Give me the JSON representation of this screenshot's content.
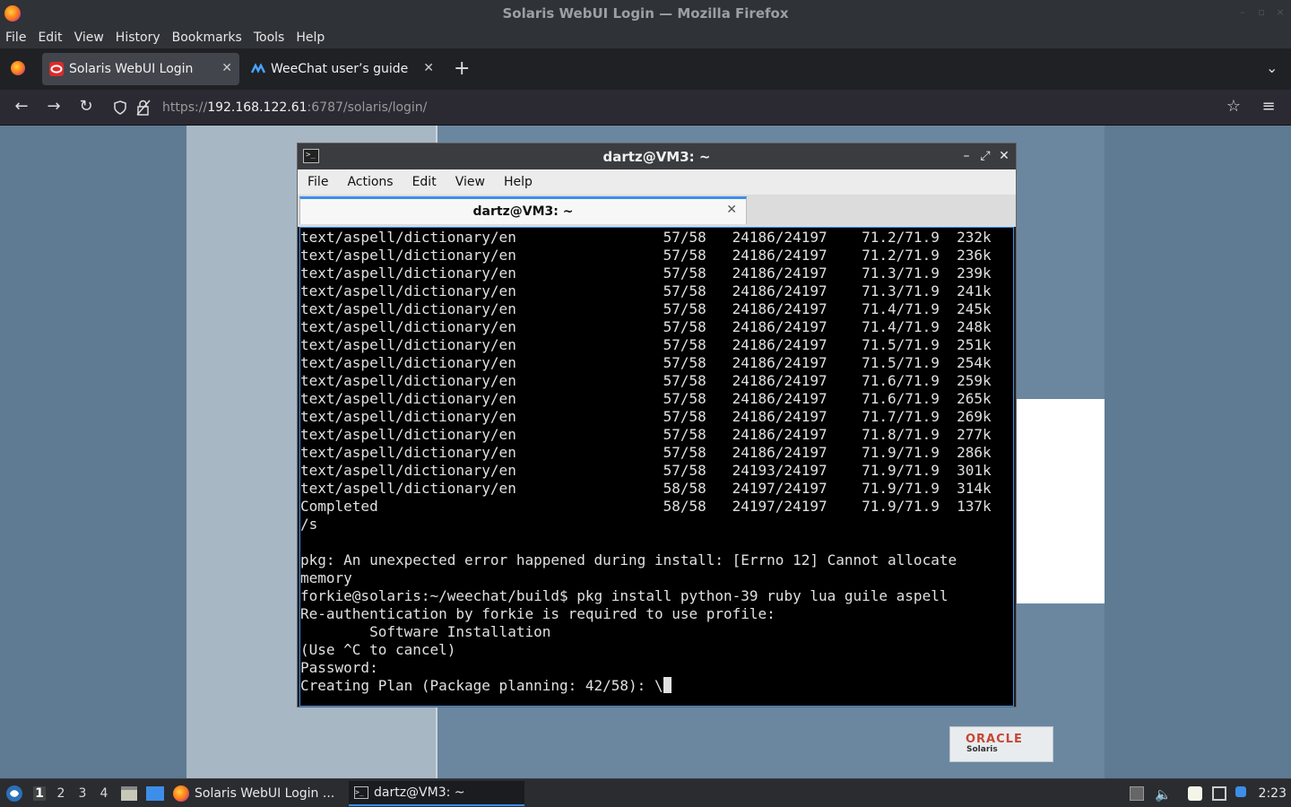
{
  "window": {
    "title": "Solaris WebUI Login — Mozilla Firefox"
  },
  "menubar": {
    "items": [
      {
        "label": "File"
      },
      {
        "label": "Edit"
      },
      {
        "label": "View"
      },
      {
        "label": "History"
      },
      {
        "label": "Bookmarks"
      },
      {
        "label": "Tools"
      },
      {
        "label": "Help"
      }
    ]
  },
  "tabs": [
    {
      "label": "Solaris WebUI Login",
      "active": true
    },
    {
      "label": "WeeChat user’s guide",
      "active": false
    }
  ],
  "nav": {
    "url_scheme": "https://",
    "url_host": "192.168.122.61",
    "url_rest": ":6787/solaris/login/"
  },
  "page": {
    "oracle_logo": "ORACLE",
    "solaris_logo": "Solaris"
  },
  "terminal": {
    "title": "dartz@VM3: ~",
    "tab_label": "dartz@VM3: ~",
    "menu": [
      {
        "label": "File"
      },
      {
        "label": "Actions"
      },
      {
        "label": "Edit"
      },
      {
        "label": "View"
      },
      {
        "label": "Help"
      }
    ],
    "lines": [
      "text/aspell/dictionary/en                 57/58   24186/24197    71.2/71.9  232k",
      "text/aspell/dictionary/en                 57/58   24186/24197    71.2/71.9  236k",
      "text/aspell/dictionary/en                 57/58   24186/24197    71.3/71.9  239k",
      "text/aspell/dictionary/en                 57/58   24186/24197    71.3/71.9  241k",
      "text/aspell/dictionary/en                 57/58   24186/24197    71.4/71.9  245k",
      "text/aspell/dictionary/en                 57/58   24186/24197    71.4/71.9  248k",
      "text/aspell/dictionary/en                 57/58   24186/24197    71.5/71.9  251k",
      "text/aspell/dictionary/en                 57/58   24186/24197    71.5/71.9  254k",
      "text/aspell/dictionary/en                 57/58   24186/24197    71.6/71.9  259k",
      "text/aspell/dictionary/en                 57/58   24186/24197    71.6/71.9  265k",
      "text/aspell/dictionary/en                 57/58   24186/24197    71.7/71.9  269k",
      "text/aspell/dictionary/en                 57/58   24186/24197    71.8/71.9  277k",
      "text/aspell/dictionary/en                 57/58   24186/24197    71.9/71.9  286k",
      "text/aspell/dictionary/en                 57/58   24193/24197    71.9/71.9  301k",
      "text/aspell/dictionary/en                 58/58   24197/24197    71.9/71.9  314k",
      "Completed                                 58/58   24197/24197    71.9/71.9  137k",
      "/s",
      "",
      "pkg: An unexpected error happened during install: [Errno 12] Cannot allocate",
      "memory",
      "forkie@solaris:~/weechat/build$ pkg install python-39 ruby lua guile aspell",
      "Re-authentication by forkie is required to use profile:",
      "        Software Installation",
      "(Use ^C to cancel)",
      "Password:",
      "Creating Plan (Package planning: 42/58): \\"
    ]
  },
  "taskbar": {
    "workspaces": [
      "1",
      "2",
      "3",
      "4"
    ],
    "apps": [
      {
        "label": "Solaris WebUI Login ..."
      },
      {
        "label": "dartz@VM3: ~"
      }
    ],
    "clock": "2:23"
  }
}
